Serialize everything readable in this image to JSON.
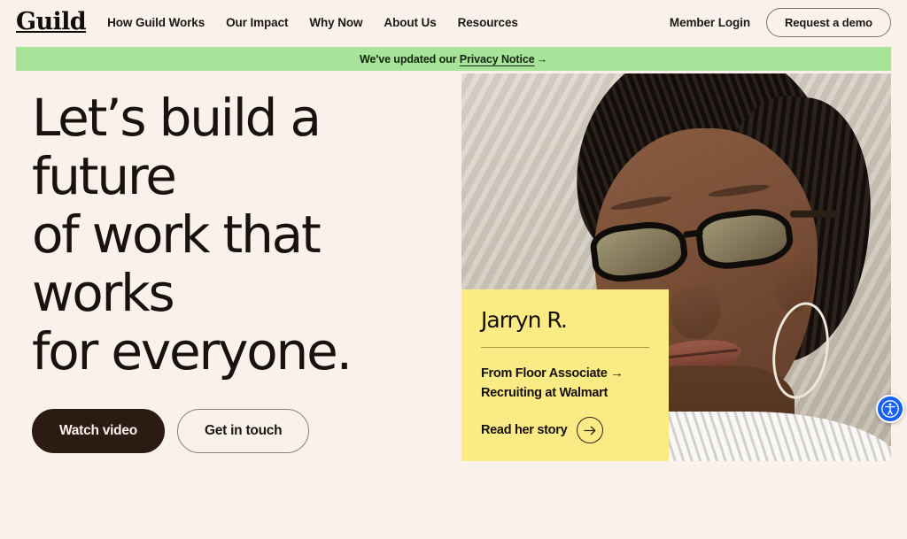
{
  "brand": {
    "logo_text": "Guild",
    "colors": {
      "page_background": "#faf1ea",
      "banner_green": "#a7e398",
      "card_yellow": "#fbeb84",
      "button_dark": "#2b1b12",
      "text_dark": "#1c1614",
      "accessibility_blue": "#1560f5"
    }
  },
  "header": {
    "nav_items": [
      {
        "label": "How Guild Works"
      },
      {
        "label": "Our Impact"
      },
      {
        "label": "Why Now"
      },
      {
        "label": "About Us"
      },
      {
        "label": "Resources"
      }
    ],
    "member_login_label": "Member Login",
    "demo_button_label": "Request a demo"
  },
  "announcement": {
    "prefix": "We've updated our ",
    "link_label": "Privacy Notice",
    "arrow": "→"
  },
  "hero": {
    "title": "Let’s build a future\nof work that works\nfor everyone.",
    "primary_button_label": "Watch video",
    "secondary_button_label": "Get in touch",
    "image_alt": "Portrait of a smiling woman wearing black cat-eye glasses and large silver hoop earrings, against a beige textured wall"
  },
  "story_card": {
    "name": "Jarryn R.",
    "role": "From Floor Associate →\nRecruiting at Walmart",
    "cta_label": "Read her story",
    "cta_icon": "arrow-right-icon"
  },
  "accessibility": {
    "widget_icon": "accessibility-person-icon",
    "widget_label": "Accessibility options"
  }
}
